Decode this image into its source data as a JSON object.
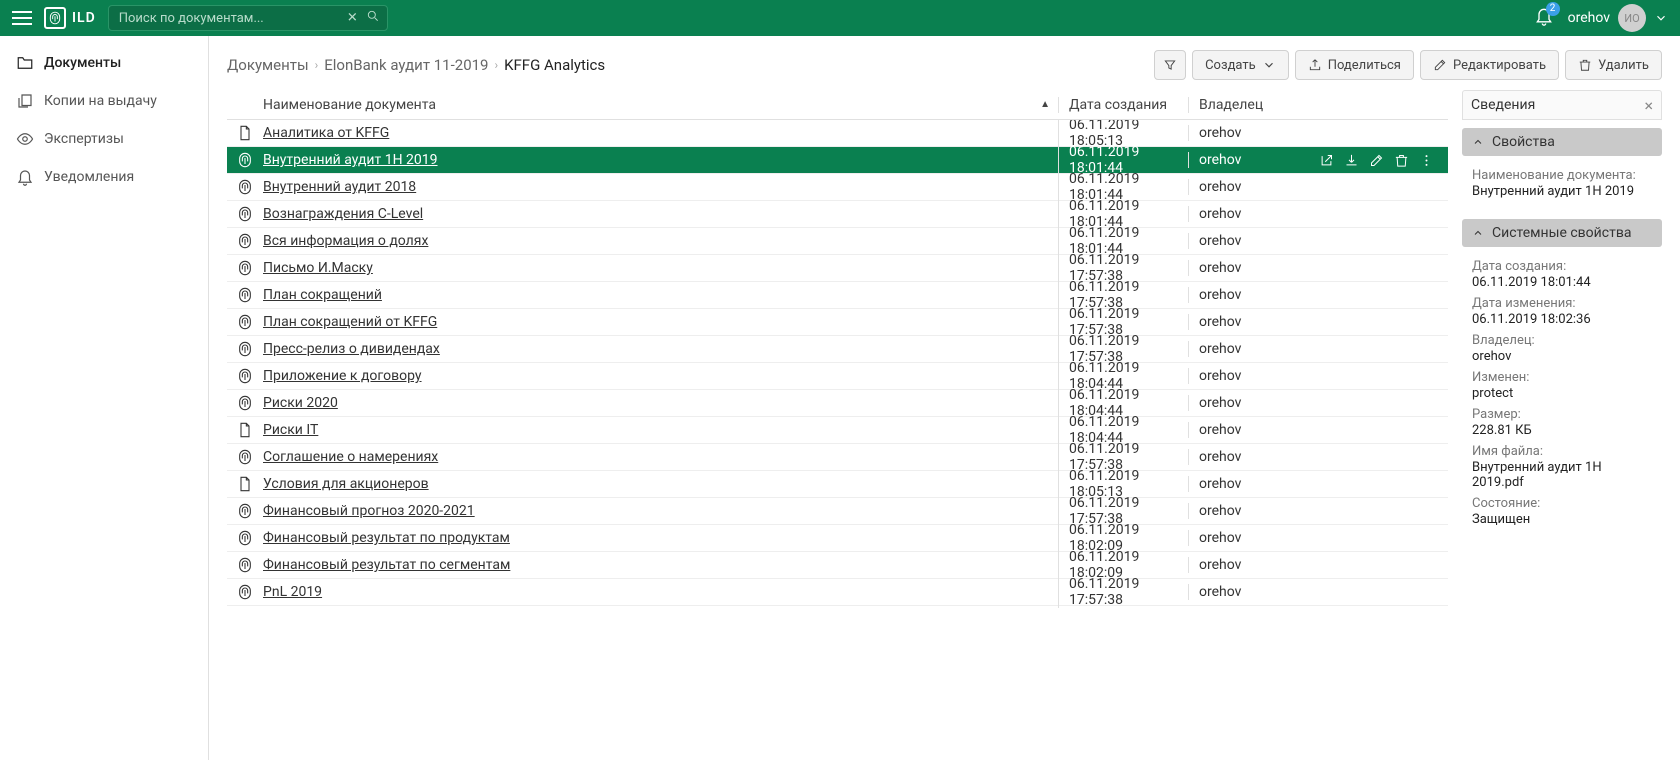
{
  "app": {
    "brand": "ILD"
  },
  "search": {
    "placeholder": "Поиск по документам..."
  },
  "notifications": {
    "count": "2"
  },
  "user": {
    "name": "orehov",
    "initials": "ИО"
  },
  "sidebar": {
    "items": [
      {
        "label": "Документы"
      },
      {
        "label": "Копии на выдачу"
      },
      {
        "label": "Экспертизы"
      },
      {
        "label": "Уведомления"
      }
    ]
  },
  "breadcrumb": {
    "parts": [
      "Документы",
      "ElonBank аудит 11-2019",
      "KFFG Analytics"
    ]
  },
  "toolbar": {
    "create": "Создать",
    "share": "Поделиться",
    "edit": "Редактировать",
    "delete": "Удалить"
  },
  "table": {
    "columns": {
      "name": "Наименование документа",
      "date": "Дата создания",
      "owner": "Владелец"
    },
    "rows": [
      {
        "icon": "doc",
        "name": "Аналитика от KFFG",
        "date": "06.11.2019 18:05:13",
        "owner": "orehov"
      },
      {
        "icon": "fp",
        "name": "Внутренний аудит 1Н 2019",
        "date": "06.11.2019 18:01:44",
        "owner": "orehov",
        "selected": true
      },
      {
        "icon": "fp",
        "name": "Внутренний аудит 2018",
        "date": "06.11.2019 18:01:44",
        "owner": "orehov"
      },
      {
        "icon": "fp",
        "name": "Вознаграждения C-Level",
        "date": "06.11.2019 18:01:44",
        "owner": "orehov"
      },
      {
        "icon": "fp",
        "name": "Вся информация о долях",
        "date": "06.11.2019 18:01:44",
        "owner": "orehov"
      },
      {
        "icon": "fp",
        "name": "Письмо И.Маску",
        "date": "06.11.2019 17:57:38",
        "owner": "orehov"
      },
      {
        "icon": "fp",
        "name": "План сокращений",
        "date": "06.11.2019 17:57:38",
        "owner": "orehov"
      },
      {
        "icon": "fp",
        "name": "План сокращений от KFFG",
        "date": "06.11.2019 17:57:38",
        "owner": "orehov"
      },
      {
        "icon": "fp",
        "name": "Пресс-релиз о дивидендах",
        "date": "06.11.2019 17:57:38",
        "owner": "orehov"
      },
      {
        "icon": "fp",
        "name": "Приложение к договору",
        "date": "06.11.2019 18:04:44",
        "owner": "orehov"
      },
      {
        "icon": "fp",
        "name": "Риски 2020",
        "date": "06.11.2019 18:04:44",
        "owner": "orehov"
      },
      {
        "icon": "doc",
        "name": "Риски IT",
        "date": "06.11.2019 18:04:44",
        "owner": "orehov"
      },
      {
        "icon": "fp",
        "name": "Соглашение о намерениях",
        "date": "06.11.2019 17:57:38",
        "owner": "orehov"
      },
      {
        "icon": "doc",
        "name": "Условия для акционеров",
        "date": "06.11.2019 18:05:13",
        "owner": "orehov"
      },
      {
        "icon": "fp",
        "name": "Финансовый прогноз 2020-2021",
        "date": "06.11.2019 17:57:38",
        "owner": "orehov"
      },
      {
        "icon": "fp",
        "name": "Финансовый результат по продуктам",
        "date": "06.11.2019 18:02:09",
        "owner": "orehov"
      },
      {
        "icon": "fp",
        "name": "Финансовый результат по сегментам",
        "date": "06.11.2019 18:02:09",
        "owner": "orehov"
      },
      {
        "icon": "fp",
        "name": "PnL 2019",
        "date": "06.11.2019 17:57:38",
        "owner": "orehov"
      }
    ]
  },
  "details": {
    "title": "Сведения",
    "section1": {
      "title": "Свойства",
      "nameLabel": "Наименование документа:",
      "nameValue": "Внутренний аудит 1Н 2019"
    },
    "section2": {
      "title": "Системные свойства",
      "createdLabel": "Дата создания:",
      "createdValue": "06.11.2019 18:01:44",
      "modifiedLabel": "Дата изменения:",
      "modifiedValue": "06.11.2019 18:02:36",
      "ownerLabel": "Владелец:",
      "ownerValue": "orehov",
      "changedByLabel": "Изменен:",
      "changedByValue": "protect",
      "sizeLabel": "Размер:",
      "sizeValue": "228.81 КБ",
      "filenameLabel": "Имя файла:",
      "filenameValue": "Внутренний аудит 1Н 2019.pdf",
      "stateLabel": "Состояние:",
      "stateValue": "Защищен"
    }
  }
}
